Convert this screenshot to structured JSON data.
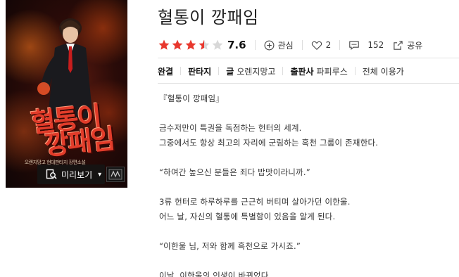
{
  "book": {
    "title": "혈통이 깡패임",
    "rating": "7.6",
    "stars_filled": 3.5,
    "stars_total": 5,
    "colors": {
      "star": "#e8372d",
      "star_empty": "#d8d8d8"
    }
  },
  "cover": {
    "title_line1": "혈통이",
    "title_line2": "깡패임",
    "subtitle": "오렌지망고 현대판타지 장편소설",
    "logo_text": "",
    "preview_label": "미리보기",
    "preview_icon": "magnifier-book-icon",
    "caret_icon": "chevron-down-icon"
  },
  "actions": {
    "bookmark": {
      "label": "관심",
      "icon": "plus-circle-icon"
    },
    "like": {
      "count": "2",
      "icon": "heart-icon"
    },
    "comment": {
      "count": "152",
      "icon": "comment-icon"
    },
    "share": {
      "label": "공유",
      "icon": "share-icon"
    }
  },
  "info": {
    "status": "완결",
    "genre": "판타지",
    "author_label": "글",
    "author": "오렌지망고",
    "publisher_label": "출판사",
    "publisher": "파피루스",
    "age": "전체 이용가"
  },
  "description": {
    "p1": "『혈통이 깡패임』",
    "p2a": "금수저만이 특권을 독점하는 헌터의 세계.",
    "p2b": "그중에서도 항상 최고의 자리에 군림하는 흑천 그룹이 존재한다.",
    "p3": "“하여간 높으신 분들은 죄다 밥맛이라니까.”",
    "p4a": "3류 헌터로 하루하루를 근근히 버티며 살아가던 이한울.",
    "p4b": "어느 날, 자신의 혈통에 특별함이 있음을 알게 된다.",
    "p5": "“이한울 님, 저와 함께 흑천으로 가시죠.”",
    "p6": "이날, 이한울의 인생이 바뀌었다."
  }
}
